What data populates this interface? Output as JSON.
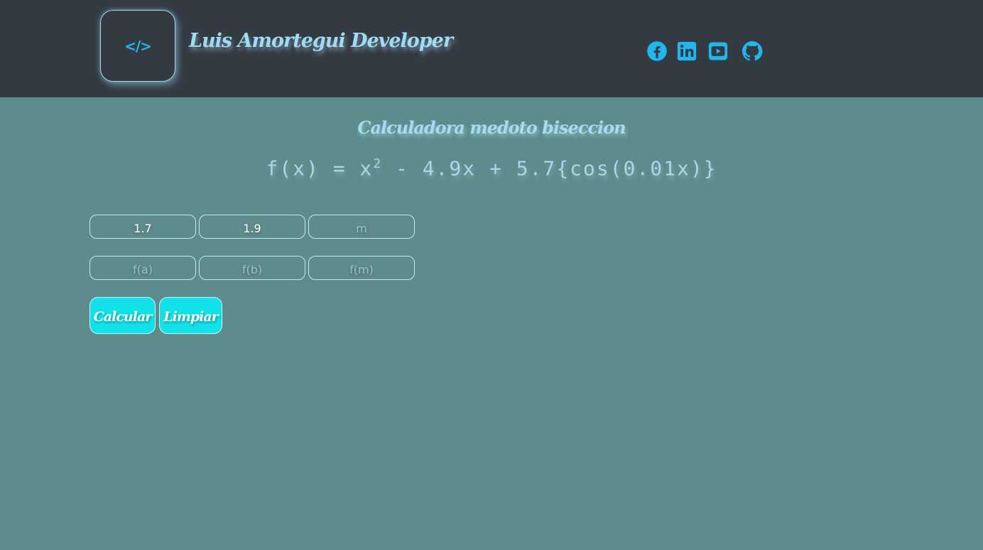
{
  "header": {
    "logo_icon": "code-icon",
    "logo_glyph": "</>",
    "brand_name": "Luis Amortegui Developer",
    "social": [
      {
        "name": "facebook-icon",
        "color": "#1fb8ee"
      },
      {
        "name": "linkedin-icon",
        "color": "#1fb8ee"
      },
      {
        "name": "youtube-icon",
        "color": "#1fb8ee"
      },
      {
        "name": "github-icon",
        "color": "#1fb8ee"
      }
    ]
  },
  "main": {
    "title": "Calculadora medoto biseccion",
    "formula": {
      "prefix": "f(x) = x",
      "exponent": "2",
      "suffix": " - 4.9x + 5.7{cos(0.01x)}"
    },
    "inputs": {
      "a": {
        "value": "1.7",
        "placeholder": ""
      },
      "b": {
        "value": "1.9",
        "placeholder": ""
      },
      "m": {
        "value": "",
        "placeholder": "m"
      },
      "fa": {
        "value": "",
        "placeholder": "f(a)"
      },
      "fb": {
        "value": "",
        "placeholder": "f(b)"
      },
      "fm": {
        "value": "",
        "placeholder": "f(m)"
      }
    },
    "buttons": {
      "calculate": "Calcular",
      "clear": "Limpiar"
    }
  },
  "colors": {
    "header_bg": "#343a42",
    "page_bg": "#5e8b8b",
    "accent": "#1fb8ee",
    "button_bg": "#11e2e9"
  }
}
